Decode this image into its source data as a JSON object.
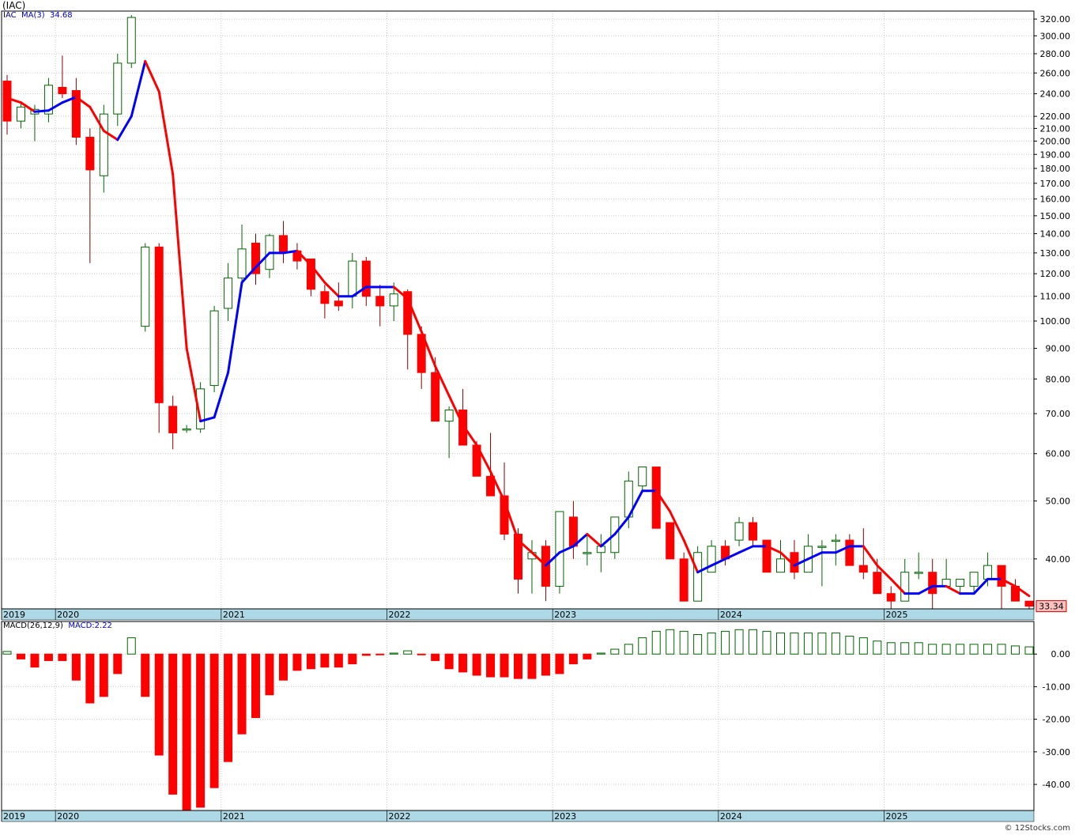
{
  "header": {
    "symbol": "(IAC)"
  },
  "footer": {
    "copyright": "© 12Stocks.com"
  },
  "colors": {
    "up": "#006600",
    "down": "#ff0000",
    "ma_up": "#0000ff",
    "ma_down": "#ff0000",
    "timebar": "#add8e6",
    "grid": "#c8c8c8",
    "last_box": "#ffc0c0"
  },
  "chart_data": [
    {
      "type": "candlestick",
      "scale": "log",
      "ylim": [
        33,
        330
      ],
      "legend": {
        "symbol": "IAC",
        "ma_label": "MA(3)",
        "ma_value": "34.68"
      },
      "last_price": "33.34",
      "yticks": [
        320,
        300,
        280,
        260,
        240,
        220,
        210,
        200,
        190,
        180,
        170,
        160,
        150,
        140,
        130,
        120,
        110,
        100,
        90,
        80,
        70,
        60,
        50,
        40
      ],
      "ytick_labels": [
        "320.00",
        "300.00",
        "280.00",
        "260.00",
        "240.00",
        "220.00",
        "210.00",
        "200.00",
        "190.00",
        "180.00",
        "170.00",
        "160.00",
        "150.00",
        "140.00",
        "130.00",
        "120.00",
        "110.00",
        "100.00",
        "90.00",
        "80.00",
        "70.00",
        "60.00",
        "50.00",
        "40.00"
      ],
      "year_labels": [
        {
          "label": "2019",
          "index": -0.5
        },
        {
          "label": "2020",
          "index": 3.5
        },
        {
          "label": "2021",
          "index": 15.5
        },
        {
          "label": "2022",
          "index": 27.5
        },
        {
          "label": "2023",
          "index": 39.5
        },
        {
          "label": "2024",
          "index": 51.5
        },
        {
          "label": "2025",
          "index": 63.5
        }
      ],
      "candles": [
        {
          "o": 252,
          "h": 258,
          "l": 205,
          "c": 216
        },
        {
          "o": 216,
          "h": 232,
          "l": 210,
          "c": 228
        },
        {
          "o": 222,
          "h": 230,
          "l": 200,
          "c": 226
        },
        {
          "o": 222,
          "h": 255,
          "l": 215,
          "c": 248
        },
        {
          "o": 246,
          "h": 278,
          "l": 236,
          "c": 240
        },
        {
          "o": 243,
          "h": 255,
          "l": 197,
          "c": 203
        },
        {
          "o": 203,
          "h": 210,
          "l": 125,
          "c": 179
        },
        {
          "o": 175,
          "h": 230,
          "l": 164,
          "c": 222
        },
        {
          "o": 222,
          "h": 280,
          "l": 212,
          "c": 270
        },
        {
          "o": 270,
          "h": 325,
          "l": 265,
          "c": 322
        },
        {
          "o": 98,
          "h": 135,
          "l": 96,
          "c": 133
        },
        {
          "o": 133,
          "h": 135,
          "l": 65,
          "c": 73
        },
        {
          "o": 72,
          "h": 75,
          "l": 61,
          "c": 65
        },
        {
          "o": 66,
          "h": 67,
          "l": 65,
          "c": 66
        },
        {
          "o": 66,
          "h": 79,
          "l": 65,
          "c": 77
        },
        {
          "o": 78,
          "h": 106,
          "l": 76,
          "c": 104
        },
        {
          "o": 105,
          "h": 125,
          "l": 100,
          "c": 118
        },
        {
          "o": 118,
          "h": 145,
          "l": 115,
          "c": 132
        },
        {
          "o": 135,
          "h": 140,
          "l": 115,
          "c": 120
        },
        {
          "o": 122,
          "h": 140,
          "l": 118,
          "c": 139
        },
        {
          "o": 139,
          "h": 147,
          "l": 125,
          "c": 130
        },
        {
          "o": 131,
          "h": 135,
          "l": 122,
          "c": 126
        },
        {
          "o": 127,
          "h": 127,
          "l": 110,
          "c": 113
        },
        {
          "o": 112,
          "h": 115,
          "l": 101,
          "c": 107
        },
        {
          "o": 108,
          "h": 116,
          "l": 104,
          "c": 106
        },
        {
          "o": 110,
          "h": 130,
          "l": 105,
          "c": 126
        },
        {
          "o": 126,
          "h": 128,
          "l": 106,
          "c": 110
        },
        {
          "o": 110,
          "h": 115,
          "l": 98,
          "c": 106
        },
        {
          "o": 106,
          "h": 116,
          "l": 100,
          "c": 111
        },
        {
          "o": 112,
          "h": 113,
          "l": 83,
          "c": 95
        },
        {
          "o": 95,
          "h": 98,
          "l": 77,
          "c": 82
        },
        {
          "o": 82,
          "h": 87,
          "l": 68,
          "c": 68
        },
        {
          "o": 68,
          "h": 72,
          "l": 59,
          "c": 71
        },
        {
          "o": 71,
          "h": 77,
          "l": 64,
          "c": 62
        },
        {
          "o": 62,
          "h": 63,
          "l": 55,
          "c": 55
        },
        {
          "o": 55,
          "h": 65,
          "l": 52,
          "c": 51
        },
        {
          "o": 51,
          "h": 58,
          "l": 43,
          "c": 44
        },
        {
          "o": 44,
          "h": 45,
          "l": 35,
          "c": 37
        },
        {
          "o": 40,
          "h": 43,
          "l": 35,
          "c": 41
        },
        {
          "o": 42,
          "h": 43,
          "l": 34,
          "c": 36
        },
        {
          "o": 36,
          "h": 48,
          "l": 35,
          "c": 48
        },
        {
          "o": 47,
          "h": 50,
          "l": 40,
          "c": 42
        },
        {
          "o": 41,
          "h": 44,
          "l": 39,
          "c": 41
        },
        {
          "o": 41,
          "h": 44,
          "l": 38,
          "c": 42
        },
        {
          "o": 41,
          "h": 47,
          "l": 40,
          "c": 47
        },
        {
          "o": 47,
          "h": 56,
          "l": 45,
          "c": 54
        },
        {
          "o": 53,
          "h": 57,
          "l": 52,
          "c": 57
        },
        {
          "o": 57,
          "h": 57,
          "l": 45,
          "c": 45
        },
        {
          "o": 46,
          "h": 46,
          "l": 40,
          "c": 40
        },
        {
          "o": 40,
          "h": 41,
          "l": 34,
          "c": 34
        },
        {
          "o": 34,
          "h": 42,
          "l": 34,
          "c": 41
        },
        {
          "o": 38,
          "h": 43,
          "l": 38,
          "c": 42
        },
        {
          "o": 42,
          "h": 43,
          "l": 39,
          "c": 40
        },
        {
          "o": 43,
          "h": 47,
          "l": 42,
          "c": 46
        },
        {
          "o": 46,
          "h": 47,
          "l": 42,
          "c": 43
        },
        {
          "o": 43,
          "h": 43,
          "l": 38,
          "c": 38
        },
        {
          "o": 38,
          "h": 43,
          "l": 38,
          "c": 40
        },
        {
          "o": 41,
          "h": 43,
          "l": 37,
          "c": 38
        },
        {
          "o": 38,
          "h": 44,
          "l": 38,
          "c": 42
        },
        {
          "o": 42,
          "h": 43,
          "l": 36,
          "c": 42
        },
        {
          "o": 43,
          "h": 44,
          "l": 39,
          "c": 43
        },
        {
          "o": 43,
          "h": 44,
          "l": 39,
          "c": 39
        },
        {
          "o": 39,
          "h": 45,
          "l": 37,
          "c": 38
        },
        {
          "o": 38,
          "h": 40,
          "l": 35,
          "c": 35
        },
        {
          "o": 35,
          "h": 36,
          "l": 33,
          "c": 34
        },
        {
          "o": 34,
          "h": 40,
          "l": 34,
          "c": 38
        },
        {
          "o": 38,
          "h": 41,
          "l": 37,
          "c": 38
        },
        {
          "o": 38,
          "h": 40,
          "l": 33,
          "c": 35
        },
        {
          "o": 36,
          "h": 40,
          "l": 36,
          "c": 37
        },
        {
          "o": 36,
          "h": 37,
          "l": 35,
          "c": 37
        },
        {
          "o": 36,
          "h": 38,
          "l": 35,
          "c": 38
        },
        {
          "o": 37,
          "h": 41,
          "l": 36,
          "c": 39
        },
        {
          "o": 39,
          "h": 39,
          "l": 33,
          "c": 36
        },
        {
          "o": 36,
          "h": 37,
          "l": 34,
          "c": 34
        },
        {
          "o": 34,
          "h": 34,
          "l": 33,
          "c": 33.34
        }
      ],
      "ma3": [
        236,
        232,
        224,
        225,
        232,
        237,
        228,
        208,
        201,
        220,
        272,
        242,
        176,
        90,
        68,
        69,
        82,
        116,
        123,
        130,
        130,
        131,
        124,
        116,
        110,
        110,
        114,
        114,
        114,
        109,
        96,
        84,
        75,
        67,
        62,
        56,
        50,
        43,
        41,
        39,
        41,
        42,
        44,
        42,
        44,
        47,
        52,
        52,
        48,
        43,
        38,
        39,
        40,
        41,
        42,
        42,
        41,
        39,
        40,
        41,
        41,
        42,
        42,
        39,
        37,
        35,
        35,
        36,
        36,
        35,
        35,
        37,
        37,
        36,
        34.68
      ]
    },
    {
      "type": "bar",
      "title": "MACD(26,12,9)",
      "legend": {
        "label": "MACD(26,12,9)",
        "value_label": "MACD:2.22"
      },
      "ylim": [
        -48,
        10
      ],
      "yticks": [
        0,
        -10,
        -20,
        -30,
        -40
      ],
      "ytick_labels": [
        "0.00",
        "-10.00",
        "-20.00",
        "-30.00",
        "-40.00"
      ],
      "values": [
        0.8,
        -1.5,
        -4,
        -2,
        -2,
        -8,
        -15,
        -13,
        -6,
        5,
        -13,
        -31,
        -43,
        -48,
        -47,
        -41,
        -33,
        -24.5,
        -19.5,
        -12.5,
        -8,
        -5,
        -4.5,
        -4,
        -4,
        -3,
        -0.4,
        -0.2,
        0.3,
        1,
        -0.2,
        -2,
        -4.5,
        -5.5,
        -6.5,
        -7,
        -7,
        -7.5,
        -7.5,
        -6.5,
        -6,
        -3,
        -1.5,
        0.3,
        1.5,
        3,
        5,
        7,
        7.5,
        7,
        6,
        6.5,
        7,
        7.5,
        7.5,
        7,
        6.5,
        6.5,
        6.5,
        6.5,
        6.5,
        5.5,
        5,
        4,
        3.5,
        3.5,
        3.5,
        3,
        3,
        3,
        3,
        3,
        3,
        2.5,
        2.22
      ]
    }
  ]
}
